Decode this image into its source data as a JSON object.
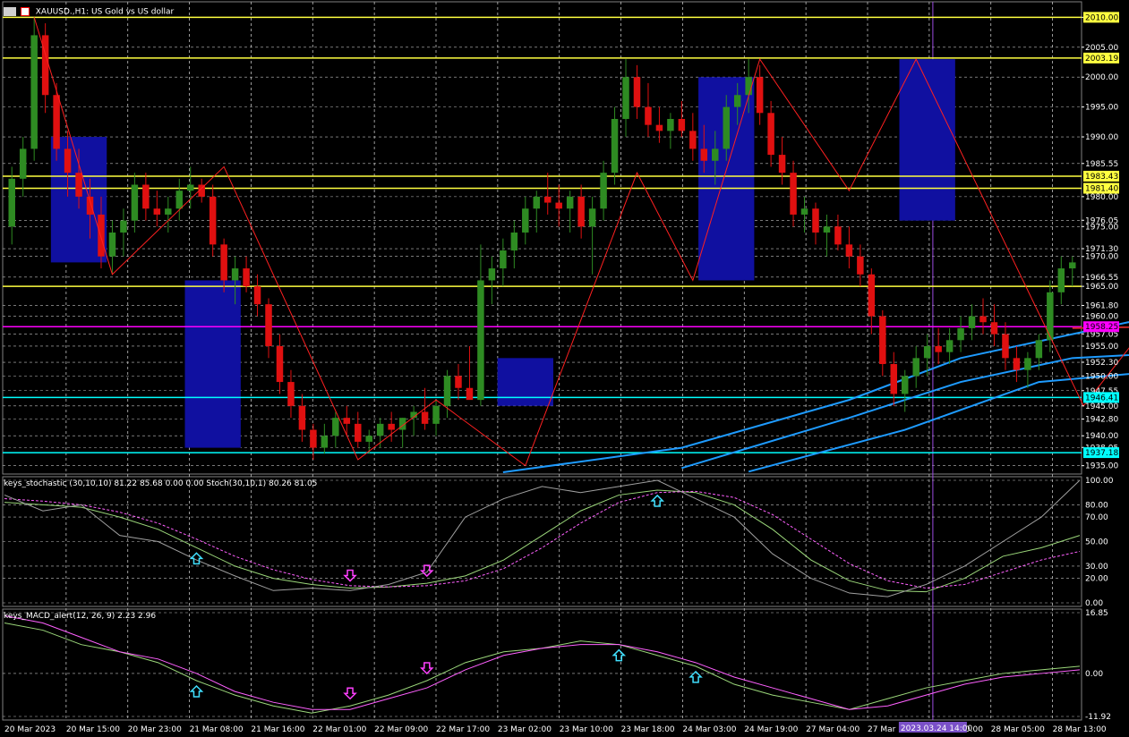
{
  "window": {
    "symbol_title": "XAUUSD.,H1: US Gold vs US dollar",
    "stoch_title": "keys_stochastic (30,10,10) 81.22 85.68 0.00 0.00 Stoch(30,10,1) 80.26 81.05",
    "macd_title": "keys_MACD_alert(12, 26, 9) 2.23 2.96",
    "crosshair_time": "2023.03.24 14:00"
  },
  "colors": {
    "background": "#000000",
    "bull": "#2e8b22",
    "bear": "#e01010",
    "zigzag": "#ff2020",
    "ma": "#1e9bff",
    "ma_red": "#c8282a",
    "level_yellow": "#ffff40",
    "level_cyan": "#00ffff",
    "level_magenta": "#ff00ff",
    "zone": "#1010a0",
    "stoch_main": "#9bd77a",
    "stoch_signal": "#ff60ff",
    "stoch_raw": "#a0a0a0",
    "macd_main": "#9bd77a",
    "macd_signal": "#ff60ff"
  },
  "chart_data": [
    {
      "type": "candlestick",
      "title": "XAUUSD.,H1: US Gold vs US dollar",
      "ylim": [
        1933.6,
        2011.4
      ],
      "x_labels": [
        "20 Mar 2023",
        "20 Mar 15:00",
        "20 Mar 23:00",
        "21 Mar 08:00",
        "21 Mar 16:00",
        "22 Mar 01:00",
        "22 Mar 09:00",
        "22 Mar 17:00",
        "23 Mar 02:00",
        "23 Mar 10:00",
        "23 Mar 18:00",
        "24 Mar 03:00",
        "24 Mar 19:00",
        "27 Mar 04:00",
        "27 Mar 12:00",
        "27 Mar 20:00",
        "28 Mar 05:00",
        "28 Mar 13:00"
      ],
      "y_ticks": [
        "2010.00",
        "2005.00",
        "2000.00",
        "1995.00",
        "1990.00",
        "1985.55",
        "1980.00",
        "1976.05",
        "1975.00",
        "1971.30",
        "1970.00",
        "1966.55",
        "1965.00",
        "1961.80",
        "1960.00",
        "1957.05",
        "1955.00",
        "1952.30",
        "1950.00",
        "1947.55",
        "1945.00",
        "1942.80",
        "1940.00",
        "1938.05",
        "1935.00"
      ],
      "levels": [
        {
          "price": 2010.0,
          "label": "2010.00",
          "color": "yellow"
        },
        {
          "price": 2003.19,
          "label": "2003.19",
          "color": "yellow"
        },
        {
          "price": 1983.43,
          "label": "1983.43",
          "color": "yellow"
        },
        {
          "price": 1981.4,
          "label": "1981.40",
          "color": "yellow"
        },
        {
          "price": 1965.0,
          "label": "",
          "color": "yellow"
        },
        {
          "price": 1958.25,
          "label": "1958.25",
          "color": "magenta"
        },
        {
          "price": 1946.41,
          "label": "1946.41",
          "color": "cyan"
        },
        {
          "price": 1937.18,
          "label": "1937.18",
          "color": "cyan"
        }
      ],
      "candles": [
        [
          1975,
          1985,
          1972,
          1983
        ],
        [
          1983,
          1990,
          1980,
          1988
        ],
        [
          1988,
          2010,
          1986,
          2007
        ],
        [
          2007,
          2009,
          1994,
          1997
        ],
        [
          1997,
          1999,
          1986,
          1988
        ],
        [
          1988,
          1991,
          1980,
          1984
        ],
        [
          1984,
          1988,
          1978,
          1980
        ],
        [
          1980,
          1983,
          1973,
          1977
        ],
        [
          1977,
          1980,
          1968,
          1970
        ],
        [
          1970,
          1976,
          1967,
          1974
        ],
        [
          1974,
          1978,
          1970,
          1976
        ],
        [
          1976,
          1984,
          1974,
          1982
        ],
        [
          1982,
          1984,
          1976,
          1978
        ],
        [
          1978,
          1981,
          1975,
          1977
        ],
        [
          1977,
          1980,
          1974,
          1978
        ],
        [
          1978,
          1983,
          1976,
          1981
        ],
        [
          1981,
          1985,
          1978,
          1982
        ],
        [
          1982,
          1983,
          1979,
          1980
        ],
        [
          1980,
          1982,
          1970,
          1972
        ],
        [
          1972,
          1973,
          1964,
          1966
        ],
        [
          1966,
          1970,
          1962,
          1968
        ],
        [
          1968,
          1970,
          1964,
          1965
        ],
        [
          1965,
          1967,
          1960,
          1962
        ],
        [
          1962,
          1963,
          1953,
          1955
        ],
        [
          1955,
          1957,
          1947,
          1949
        ],
        [
          1949,
          1951,
          1943,
          1945
        ],
        [
          1945,
          1947,
          1939,
          1941
        ],
        [
          1941,
          1942,
          1936,
          1938
        ],
        [
          1938,
          1942,
          1937,
          1940
        ],
        [
          1940,
          1944,
          1938,
          1943
        ],
        [
          1943,
          1945,
          1940,
          1942
        ],
        [
          1942,
          1944,
          1938,
          1939
        ],
        [
          1939,
          1941,
          1937,
          1940
        ],
        [
          1940,
          1943,
          1938,
          1942
        ],
        [
          1942,
          1944,
          1939,
          1941
        ],
        [
          1941,
          1943,
          1938,
          1943
        ],
        [
          1943,
          1945,
          1940,
          1944
        ],
        [
          1944,
          1948,
          1941,
          1942
        ],
        [
          1942,
          1946,
          1940,
          1945
        ],
        [
          1945,
          1951,
          1943,
          1950
        ],
        [
          1950,
          1952,
          1946,
          1948
        ],
        [
          1948,
          1955,
          1947,
          1946
        ],
        [
          1946,
          1972,
          1945,
          1966
        ],
        [
          1966,
          1970,
          1962,
          1968
        ],
        [
          1968,
          1973,
          1965,
          1971
        ],
        [
          1971,
          1976,
          1968,
          1974
        ],
        [
          1974,
          1980,
          1972,
          1978
        ],
        [
          1978,
          1981,
          1974,
          1980
        ],
        [
          1980,
          1984,
          1977,
          1979
        ],
        [
          1979,
          1982,
          1975,
          1978
        ],
        [
          1978,
          1981,
          1974,
          1980
        ],
        [
          1980,
          1982,
          1973,
          1975
        ],
        [
          1975,
          1980,
          1967,
          1978
        ],
        [
          1978,
          1986,
          1976,
          1984
        ],
        [
          1984,
          1995,
          1982,
          1993
        ],
        [
          1993,
          2003,
          1990,
          2000
        ],
        [
          2000,
          2002,
          1993,
          1995
        ],
        [
          1995,
          1999,
          1990,
          1992
        ],
        [
          1992,
          1995,
          1989,
          1991
        ],
        [
          1991,
          1994,
          1988,
          1993
        ],
        [
          1993,
          1996,
          1990,
          1991
        ],
        [
          1991,
          1994,
          1986,
          1988
        ],
        [
          1988,
          1992,
          1984,
          1986
        ],
        [
          1986,
          1991,
          1982,
          1988
        ],
        [
          1988,
          1997,
          1986,
          1995
        ],
        [
          1995,
          1999,
          1992,
          1997
        ],
        [
          1997,
          2003,
          1994,
          2000
        ],
        [
          2000,
          2002,
          1992,
          1994
        ],
        [
          1994,
          1996,
          1985,
          1987
        ],
        [
          1987,
          1990,
          1982,
          1984
        ],
        [
          1984,
          1986,
          1975,
          1977
        ],
        [
          1977,
          1980,
          1974,
          1978
        ],
        [
          1978,
          1979,
          1972,
          1974
        ],
        [
          1974,
          1977,
          1970,
          1975
        ],
        [
          1975,
          1977,
          1971,
          1972
        ],
        [
          1972,
          1975,
          1968,
          1970
        ],
        [
          1970,
          1972,
          1965,
          1967
        ],
        [
          1967,
          1968,
          1957,
          1960
        ],
        [
          1960,
          1961,
          1950,
          1952
        ],
        [
          1952,
          1954,
          1945,
          1947
        ],
        [
          1947,
          1951,
          1944,
          1950
        ],
        [
          1950,
          1955,
          1948,
          1953
        ],
        [
          1953,
          1957,
          1950,
          1955
        ],
        [
          1955,
          1958,
          1952,
          1954
        ],
        [
          1954,
          1958,
          1952,
          1956
        ],
        [
          1956,
          1960,
          1954,
          1958
        ],
        [
          1958,
          1962,
          1956,
          1960
        ],
        [
          1960,
          1963,
          1957,
          1959
        ],
        [
          1959,
          1962,
          1955,
          1957
        ],
        [
          1957,
          1959,
          1951,
          1953
        ],
        [
          1953,
          1955,
          1949,
          1951
        ],
        [
          1951,
          1954,
          1948,
          1953
        ],
        [
          1953,
          1957,
          1951,
          1956
        ],
        [
          1956,
          1966,
          1954,
          1964
        ],
        [
          1964,
          1970,
          1962,
          1968
        ],
        [
          1968,
          1970,
          1965,
          1969
        ]
      ],
      "zigzag": [
        [
          2,
          2010
        ],
        [
          9,
          1967
        ],
        [
          19,
          1985
        ],
        [
          31,
          1936
        ],
        [
          38,
          1946
        ],
        [
          46,
          1935
        ],
        [
          56,
          1984
        ],
        [
          61,
          1966
        ],
        [
          67,
          2003
        ],
        [
          75,
          1981
        ],
        [
          81,
          2003
        ],
        [
          96,
          1945
        ],
        [
          104,
          1964
        ],
        [
          114,
          1948
        ],
        [
          122,
          1966
        ]
      ],
      "zones": [
        [
          4,
          8,
          1969,
          1990
        ],
        [
          16,
          20,
          1938,
          1966
        ],
        [
          44,
          48,
          1945,
          1953
        ],
        [
          62,
          66,
          1966,
          2000
        ],
        [
          80,
          84,
          1976,
          2003
        ],
        [
          101,
          104,
          1945,
          1960
        ],
        [
          116,
          119,
          1959,
          1976
        ]
      ],
      "ma_lines": [
        {
          "color": "ma",
          "points": [
            [
              44,
              1933.9
            ],
            [
              60,
              1938
            ],
            [
              75,
              1946
            ],
            [
              85,
              1953
            ],
            [
              95,
              1957
            ],
            [
              100,
              1959
            ],
            [
              110,
              1959
            ],
            [
              119,
              1958
            ]
          ]
        },
        {
          "color": "ma",
          "points": [
            [
              60,
              1934.6
            ],
            [
              75,
              1943
            ],
            [
              85,
              1949
            ],
            [
              95,
              1953
            ],
            [
              105,
              1954
            ],
            [
              115,
              1955
            ],
            [
              119,
              1956
            ]
          ]
        },
        {
          "color": "ma",
          "points": [
            [
              66,
              1934
            ],
            [
              80,
              1941
            ],
            [
              92,
              1949
            ],
            [
              104,
              1951
            ],
            [
              115,
              1952
            ],
            [
              119,
              1952.5
            ]
          ]
        },
        {
          "color": "ma_red",
          "points": [
            [
              95,
              1958
            ],
            [
              110,
              1958.5
            ],
            [
              119,
              1958
            ]
          ]
        }
      ]
    },
    {
      "type": "line",
      "title": "keys_stochastic (30,10,10) 81.22 85.68 0.00 0.00 Stoch(30,10,1) 80.26 81.05",
      "ylim": [
        0,
        100
      ],
      "y_ticks": [
        "100.00",
        "80.00",
        "70.00",
        "50.00",
        "30.00",
        "20.00",
        "0.00"
      ],
      "series": [
        {
          "color": "stoch_main",
          "values": [
            82,
            80,
            78,
            70,
            60,
            45,
            30,
            20,
            15,
            12,
            13,
            16,
            22,
            35,
            55,
            75,
            88,
            92,
            90,
            80,
            60,
            35,
            18,
            10,
            9,
            20,
            38,
            45,
            55
          ]
        },
        {
          "color": "stoch_signal",
          "values": [
            85,
            83,
            80,
            74,
            65,
            52,
            38,
            27,
            19,
            14,
            13,
            14,
            18,
            28,
            45,
            65,
            82,
            90,
            91,
            86,
            72,
            52,
            32,
            18,
            12,
            15,
            25,
            35,
            42
          ]
        },
        {
          "color": "stoch_raw",
          "values": [
            88,
            75,
            80,
            55,
            50,
            35,
            22,
            10,
            12,
            10,
            15,
            25,
            70,
            85,
            95,
            90,
            95,
            100,
            85,
            70,
            40,
            20,
            8,
            5,
            15,
            30,
            50,
            70,
            100
          ]
        }
      ],
      "arrows": [
        [
          "up",
          5
        ],
        [
          "down",
          9
        ],
        [
          "down",
          11
        ],
        [
          "up",
          17
        ]
      ]
    },
    {
      "type": "line",
      "title": "keys_MACD_alert(12, 26, 9) 2.23 2.96",
      "ylim": [
        -11.92,
        16.85
      ],
      "y_ticks": [
        "16.85",
        "0.00",
        "-11.92"
      ],
      "series": [
        {
          "color": "macd_main",
          "values": [
            14,
            12,
            8,
            6,
            3,
            -2,
            -6,
            -9,
            -11,
            -9,
            -6,
            -2,
            3,
            6,
            7,
            9,
            8,
            5,
            2,
            -3,
            -6,
            -8,
            -10,
            -7,
            -4,
            -2,
            0,
            1,
            2
          ]
        },
        {
          "color": "macd_signal",
          "values": [
            16,
            14,
            10,
            6,
            4,
            0,
            -5,
            -8,
            -10,
            -10,
            -7,
            -4,
            1,
            5,
            7,
            8,
            8,
            6,
            3,
            -1,
            -4,
            -7,
            -10,
            -9,
            -6,
            -3,
            -1,
            0,
            1
          ]
        }
      ],
      "arrows": [
        [
          "up",
          5
        ],
        [
          "down",
          9
        ],
        [
          "down",
          11
        ],
        [
          "up",
          16
        ],
        [
          "up",
          18
        ]
      ]
    }
  ]
}
